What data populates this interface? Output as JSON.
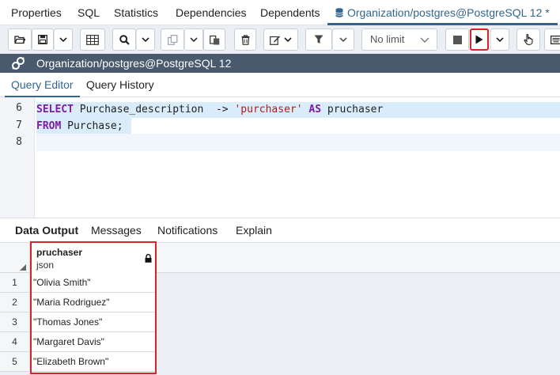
{
  "top_tabs": [
    {
      "label": "Properties"
    },
    {
      "label": "SQL"
    },
    {
      "label": "Statistics"
    },
    {
      "label": "Dependencies"
    },
    {
      "label": "Dependents"
    },
    {
      "label": "Organization/postgres@PostgreSQL 12 *"
    }
  ],
  "toolbar": {
    "limit_label": "No limit",
    "execute_button_state": "highlighted"
  },
  "connection": {
    "label": "Organization/postgres@PostgreSQL 12"
  },
  "editor_tabs": [
    {
      "label": "Query Editor"
    },
    {
      "label": "Query History"
    }
  ],
  "editor": {
    "line_numbers": [
      "6",
      "7",
      "8"
    ]
  },
  "result_tabs": [
    {
      "label": "Data Output"
    },
    {
      "label": "Messages"
    },
    {
      "label": "Notifications"
    },
    {
      "label": "Explain"
    }
  ],
  "grid": {
    "column": {
      "name": "pruchaser",
      "type": "json"
    },
    "rows": [
      {
        "num": "1",
        "value": "\"Olivia Smith\""
      },
      {
        "num": "2",
        "value": "\"Maria Rodriguez\""
      },
      {
        "num": "3",
        "value": "\"Thomas Jones\""
      },
      {
        "num": "4",
        "value": "\"Margaret Davis\""
      },
      {
        "num": "5",
        "value": "\"Elizabeth Brown\""
      }
    ]
  },
  "colors": {
    "accent": "#326690",
    "connection_bar": "#4a5a6e",
    "highlight": "#d8232a"
  }
}
